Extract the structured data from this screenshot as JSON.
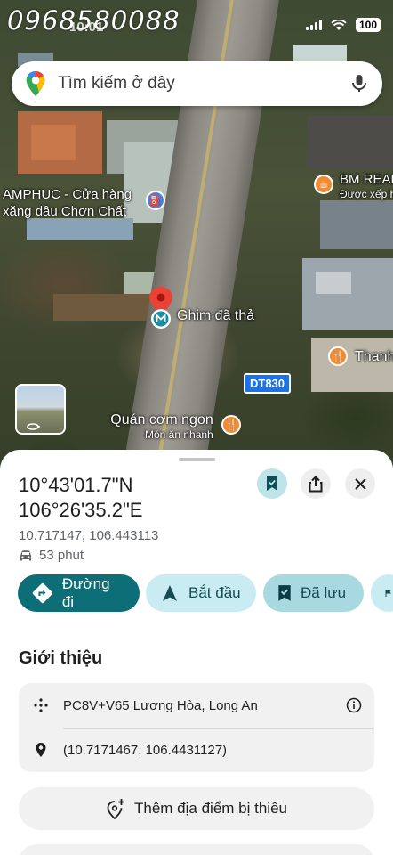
{
  "status_bar": {
    "overlay_text": "0968580088",
    "time": "10:01",
    "battery": "100"
  },
  "search": {
    "placeholder": "Tìm kiếm ở đây"
  },
  "map": {
    "labels": {
      "gas_station_line1": "AMPHUC - Cửa hàng",
      "gas_station_line2": "xăng dầu Chơn Chất",
      "bm_real_title": "BM REAL",
      "bm_real_sub": "Được xếp h",
      "thanh": "Thanh",
      "pin": "Ghim đã thả",
      "route": "DT830",
      "restaurant_title": "Quán cơm ngon",
      "restaurant_sub": "Món ăn nhanh"
    },
    "colors": {
      "pin": "#ea4335",
      "poi_orange": "#f28b30",
      "poi_blue": "#4f7cd6",
      "route_shield": "#1a73e8"
    }
  },
  "place": {
    "coord_line1": "10°43'01.7\"N",
    "coord_line2": "106°26'35.2\"E",
    "decimal": "10.717147, 106.443113",
    "drive_time": "53 phút"
  },
  "actions": {
    "directions": "Đường đi",
    "start": "Bắt đầu",
    "saved": "Đã lưu"
  },
  "intro": {
    "title": "Giới thiệu",
    "plus_code": "PC8V+V65 Lương Hòa, Long An",
    "coordinates": "(10.7171467, 106.4431127)",
    "add_missing": "Thêm địa điểm bị thiếu"
  },
  "theme": {
    "primary": "#0e6e78",
    "chip_light": "#c9ecf2",
    "card_bg": "#f1f1f1"
  }
}
